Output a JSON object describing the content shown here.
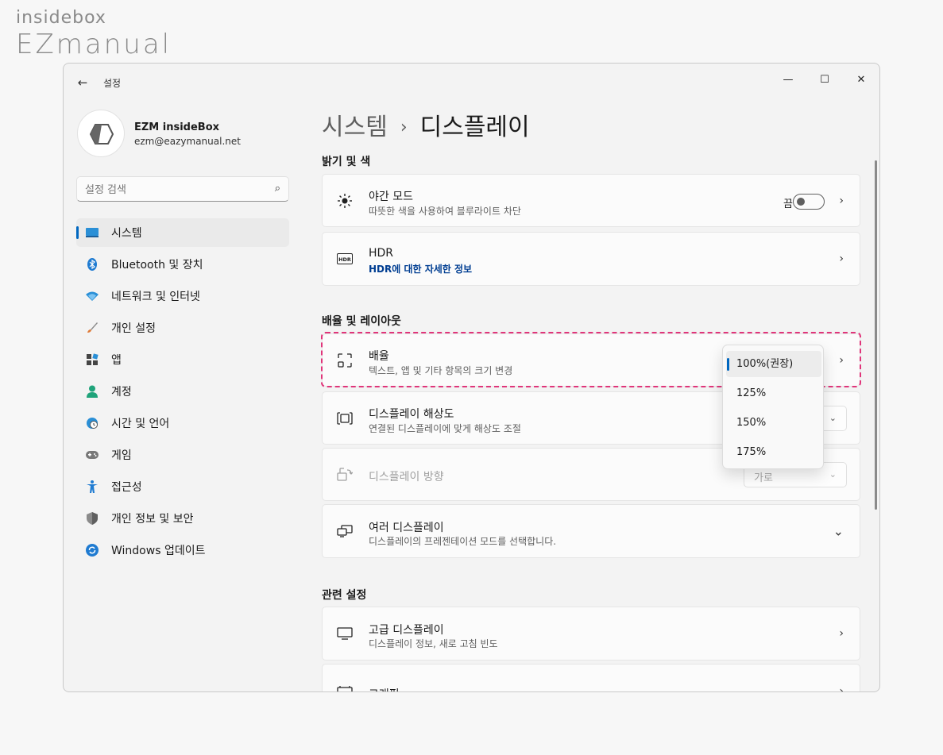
{
  "brand": {
    "top": "insidebox",
    "bottom": "EZmanual"
  },
  "window": {
    "app_title": "설정",
    "back_icon": "arrow-left-icon",
    "controls": [
      "minimize-icon",
      "maximize-icon",
      "close-icon"
    ]
  },
  "user": {
    "name": "EZM insideBox",
    "email": "ezm@eazymanual.net"
  },
  "search": {
    "placeholder": "설정 검색"
  },
  "nav": {
    "items": [
      {
        "label": "시스템",
        "icon": "monitor-icon",
        "active": true
      },
      {
        "label": "Bluetooth 및 장치",
        "icon": "bluetooth-icon"
      },
      {
        "label": "네트워크 및 인터넷",
        "icon": "wifi-icon"
      },
      {
        "label": "개인 설정",
        "icon": "brush-icon"
      },
      {
        "label": "앱",
        "icon": "apps-icon"
      },
      {
        "label": "계정",
        "icon": "person-icon"
      },
      {
        "label": "시간 및 언어",
        "icon": "globe-clock-icon"
      },
      {
        "label": "게임",
        "icon": "gamepad-icon"
      },
      {
        "label": "접근성",
        "icon": "accessibility-icon"
      },
      {
        "label": "개인 정보 및 보안",
        "icon": "shield-icon"
      },
      {
        "label": "Windows 업데이트",
        "icon": "update-icon"
      }
    ]
  },
  "header": {
    "crumb": "시스템",
    "separator": "›",
    "title": "디스플레이"
  },
  "sections": {
    "brightness": "밝기 및 색",
    "scale_layout": "배율 및 레이아웃",
    "related": "관련 설정"
  },
  "cards": {
    "night": {
      "title": "야간 모드",
      "sub": "따뜻한 색을 사용하여 블루라이트 차단",
      "toggle_label": "끔",
      "toggle_on": false
    },
    "hdr": {
      "title": "HDR",
      "link": "HDR에 대한 자세한 정보",
      "icon_text": "HDR"
    },
    "scale": {
      "title": "배율",
      "sub": "텍스트, 앱 및 기타 항목의 크기 변경"
    },
    "resolution": {
      "title": "디스플레이 해상도",
      "sub": "연결된 디스플레이에 맞게 해상도 조절"
    },
    "orientation": {
      "title": "디스플레이 방향",
      "value": "가로"
    },
    "multi": {
      "title": "여러 디스플레이",
      "sub": "디스플레이의 프레젠테이션 모드를 선택합니다."
    },
    "advanced": {
      "title": "고급 디스플레이",
      "sub": "디스플레이 정보, 새로 고침 빈도"
    },
    "graphics": {
      "title": "그래픽"
    }
  },
  "scale_dropdown": {
    "options": [
      "100%(권장)",
      "125%",
      "150%",
      "175%"
    ],
    "selected": "100%(권장)"
  },
  "colors": {
    "accent": "#0067c0",
    "highlight": "#e0357a",
    "link": "#003e92"
  }
}
